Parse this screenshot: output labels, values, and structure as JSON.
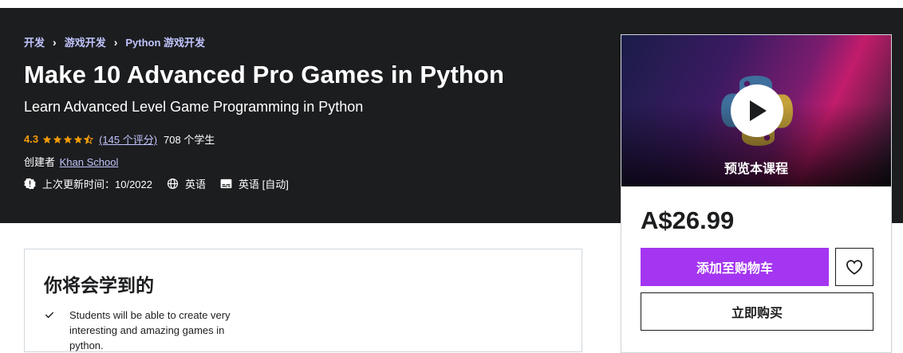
{
  "breadcrumb": [
    "开发",
    "游戏开发",
    "Python 游戏开发"
  ],
  "course": {
    "title": "Make 10 Advanced Pro Games in Python",
    "subtitle": "Learn Advanced Level Game Programming in Python",
    "rating": "4.3",
    "stars_value": 4.3,
    "reviews": "(145 个评分)",
    "students": "708 个学生",
    "creator_prefix": "创建者",
    "creator": "Khan School",
    "updated": "上次更新时间：10/2022",
    "language": "英语",
    "captions": "英语 [自动]"
  },
  "learn": {
    "title": "你将会学到的",
    "items": [
      "Students will be able to create very interesting and amazing games in python."
    ]
  },
  "sidebar": {
    "preview_label": "预览本课程",
    "price": "A$26.99",
    "add_to_cart": "添加至购物车",
    "buy_now": "立即购买"
  },
  "colors": {
    "hero_bg": "#1c1d1f",
    "accent": "#a435f0",
    "link": "#c0c4fc",
    "rating": "#f69c08"
  },
  "icons": [
    "chevron-right-icon",
    "star-icon",
    "half-star-icon",
    "alert-icon",
    "globe-icon",
    "captions-icon",
    "check-icon",
    "play-icon",
    "heart-icon",
    "python-logo-icon"
  ]
}
